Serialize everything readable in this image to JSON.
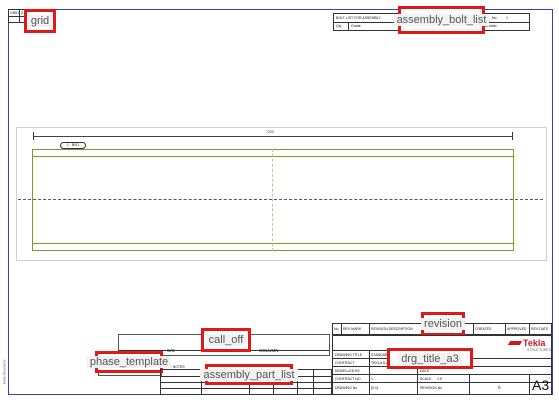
{
  "labels": {
    "grid": "grid",
    "assembly_bolt_list": "assembly_bolt_list",
    "revision": "revision",
    "drg_title_a3": "drg_title_a3",
    "call_off": "call_off",
    "phase_template": "phase_template",
    "assembly_part_list": "assembly_part_list"
  },
  "grid_header": {
    "c1": "GRID",
    "c2": "X",
    "c3": "Y",
    "c4": "CON"
  },
  "bolt_list": {
    "title": "BOLT LIST FOR ASSEMBLY",
    "col1": "Qty",
    "col2": "Grade",
    "no_label": "No.",
    "no_value": "1",
    "member_label": "Member"
  },
  "drawing": {
    "dimension": "7200",
    "tag": "1 - B/01"
  },
  "column_block": {
    "label_left": "C/C",
    "label_right": "COLUMN"
  },
  "revision_table": {
    "headers": [
      "No",
      "REV MARK",
      "REVISION DESCRIPTION",
      "CREATED",
      "APPROVED",
      "REV DATE"
    ]
  },
  "title_block": {
    "rows": [
      {
        "label": "DRAWING TITLE",
        "value": "STANDARD"
      },
      {
        "label": "CONTRACT",
        "value": "TEKLA S.A"
      },
      {
        "label": "MODELLED BY",
        "value": ""
      },
      {
        "label": "CONTRACT NO",
        "value": "1"
      },
      {
        "label": "DRAWING No",
        "value": "[0.0]"
      }
    ],
    "scale_label": "SCALE",
    "scale_value": "1:5",
    "revision_no_label": "REVISION No",
    "revision_no_value": "0",
    "sheet_size": "A3",
    "company_value": "DATE",
    "logo_text": "Tekla",
    "logo_sub": "STRUCTURES"
  },
  "phase": {
    "general_notes": "GENERAL NOTES"
  },
  "side_text": "Tekla Structures",
  "colors": {
    "frame": "#3a3ad0",
    "highlight": "#e01818",
    "beam": "#7a9a2a",
    "logo": "#d01818"
  }
}
